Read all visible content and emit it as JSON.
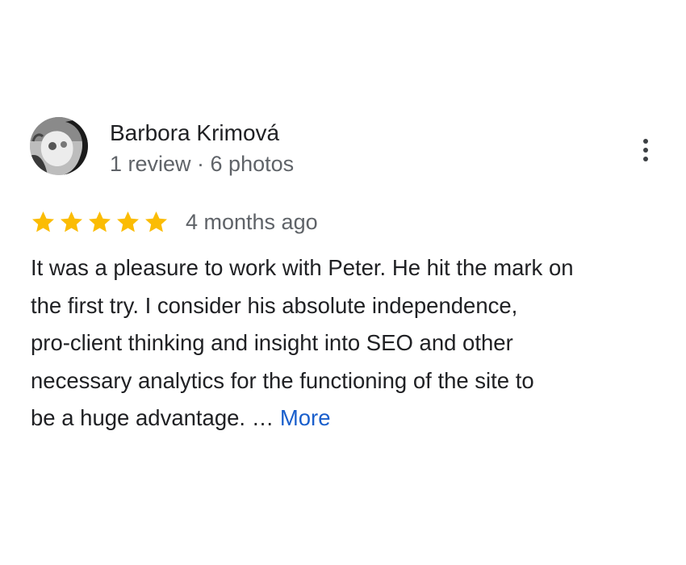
{
  "review": {
    "author": {
      "name": "Barbora Krimová",
      "meta": "1 review · 6 photos"
    },
    "rating": {
      "stars": 5,
      "max": 5,
      "star_color": "#fbbc04"
    },
    "date": "4 months ago",
    "text_lines": [
      "It was a pleasure to work with Peter. He hit the mark on",
      "the first try. I consider his absolute independence,",
      "pro-client thinking and insight into SEO and other",
      "necessary analytics for the functioning of the site to",
      "be a huge advantage. …"
    ],
    "more_label": "More",
    "link_color": "#1a5fcc",
    "options_icon": "more-vert-icon"
  }
}
